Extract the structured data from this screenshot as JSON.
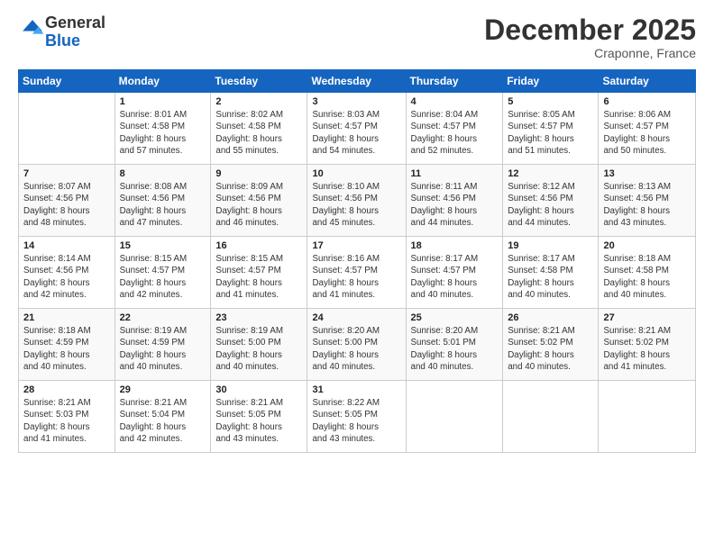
{
  "header": {
    "logo_general": "General",
    "logo_blue": "Blue",
    "month_title": "December 2025",
    "location": "Craponne, France"
  },
  "calendar": {
    "headers": [
      "Sunday",
      "Monday",
      "Tuesday",
      "Wednesday",
      "Thursday",
      "Friday",
      "Saturday"
    ],
    "weeks": [
      [
        {
          "day": "",
          "info": ""
        },
        {
          "day": "1",
          "info": "Sunrise: 8:01 AM\nSunset: 4:58 PM\nDaylight: 8 hours\nand 57 minutes."
        },
        {
          "day": "2",
          "info": "Sunrise: 8:02 AM\nSunset: 4:58 PM\nDaylight: 8 hours\nand 55 minutes."
        },
        {
          "day": "3",
          "info": "Sunrise: 8:03 AM\nSunset: 4:57 PM\nDaylight: 8 hours\nand 54 minutes."
        },
        {
          "day": "4",
          "info": "Sunrise: 8:04 AM\nSunset: 4:57 PM\nDaylight: 8 hours\nand 52 minutes."
        },
        {
          "day": "5",
          "info": "Sunrise: 8:05 AM\nSunset: 4:57 PM\nDaylight: 8 hours\nand 51 minutes."
        },
        {
          "day": "6",
          "info": "Sunrise: 8:06 AM\nSunset: 4:57 PM\nDaylight: 8 hours\nand 50 minutes."
        }
      ],
      [
        {
          "day": "7",
          "info": "Sunrise: 8:07 AM\nSunset: 4:56 PM\nDaylight: 8 hours\nand 48 minutes."
        },
        {
          "day": "8",
          "info": "Sunrise: 8:08 AM\nSunset: 4:56 PM\nDaylight: 8 hours\nand 47 minutes."
        },
        {
          "day": "9",
          "info": "Sunrise: 8:09 AM\nSunset: 4:56 PM\nDaylight: 8 hours\nand 46 minutes."
        },
        {
          "day": "10",
          "info": "Sunrise: 8:10 AM\nSunset: 4:56 PM\nDaylight: 8 hours\nand 45 minutes."
        },
        {
          "day": "11",
          "info": "Sunrise: 8:11 AM\nSunset: 4:56 PM\nDaylight: 8 hours\nand 44 minutes."
        },
        {
          "day": "12",
          "info": "Sunrise: 8:12 AM\nSunset: 4:56 PM\nDaylight: 8 hours\nand 44 minutes."
        },
        {
          "day": "13",
          "info": "Sunrise: 8:13 AM\nSunset: 4:56 PM\nDaylight: 8 hours\nand 43 minutes."
        }
      ],
      [
        {
          "day": "14",
          "info": "Sunrise: 8:14 AM\nSunset: 4:56 PM\nDaylight: 8 hours\nand 42 minutes."
        },
        {
          "day": "15",
          "info": "Sunrise: 8:15 AM\nSunset: 4:57 PM\nDaylight: 8 hours\nand 42 minutes."
        },
        {
          "day": "16",
          "info": "Sunrise: 8:15 AM\nSunset: 4:57 PM\nDaylight: 8 hours\nand 41 minutes."
        },
        {
          "day": "17",
          "info": "Sunrise: 8:16 AM\nSunset: 4:57 PM\nDaylight: 8 hours\nand 41 minutes."
        },
        {
          "day": "18",
          "info": "Sunrise: 8:17 AM\nSunset: 4:57 PM\nDaylight: 8 hours\nand 40 minutes."
        },
        {
          "day": "19",
          "info": "Sunrise: 8:17 AM\nSunset: 4:58 PM\nDaylight: 8 hours\nand 40 minutes."
        },
        {
          "day": "20",
          "info": "Sunrise: 8:18 AM\nSunset: 4:58 PM\nDaylight: 8 hours\nand 40 minutes."
        }
      ],
      [
        {
          "day": "21",
          "info": "Sunrise: 8:18 AM\nSunset: 4:59 PM\nDaylight: 8 hours\nand 40 minutes."
        },
        {
          "day": "22",
          "info": "Sunrise: 8:19 AM\nSunset: 4:59 PM\nDaylight: 8 hours\nand 40 minutes."
        },
        {
          "day": "23",
          "info": "Sunrise: 8:19 AM\nSunset: 5:00 PM\nDaylight: 8 hours\nand 40 minutes."
        },
        {
          "day": "24",
          "info": "Sunrise: 8:20 AM\nSunset: 5:00 PM\nDaylight: 8 hours\nand 40 minutes."
        },
        {
          "day": "25",
          "info": "Sunrise: 8:20 AM\nSunset: 5:01 PM\nDaylight: 8 hours\nand 40 minutes."
        },
        {
          "day": "26",
          "info": "Sunrise: 8:21 AM\nSunset: 5:02 PM\nDaylight: 8 hours\nand 40 minutes."
        },
        {
          "day": "27",
          "info": "Sunrise: 8:21 AM\nSunset: 5:02 PM\nDaylight: 8 hours\nand 41 minutes."
        }
      ],
      [
        {
          "day": "28",
          "info": "Sunrise: 8:21 AM\nSunset: 5:03 PM\nDaylight: 8 hours\nand 41 minutes."
        },
        {
          "day": "29",
          "info": "Sunrise: 8:21 AM\nSunset: 5:04 PM\nDaylight: 8 hours\nand 42 minutes."
        },
        {
          "day": "30",
          "info": "Sunrise: 8:21 AM\nSunset: 5:05 PM\nDaylight: 8 hours\nand 43 minutes."
        },
        {
          "day": "31",
          "info": "Sunrise: 8:22 AM\nSunset: 5:05 PM\nDaylight: 8 hours\nand 43 minutes."
        },
        {
          "day": "",
          "info": ""
        },
        {
          "day": "",
          "info": ""
        },
        {
          "day": "",
          "info": ""
        }
      ]
    ]
  }
}
